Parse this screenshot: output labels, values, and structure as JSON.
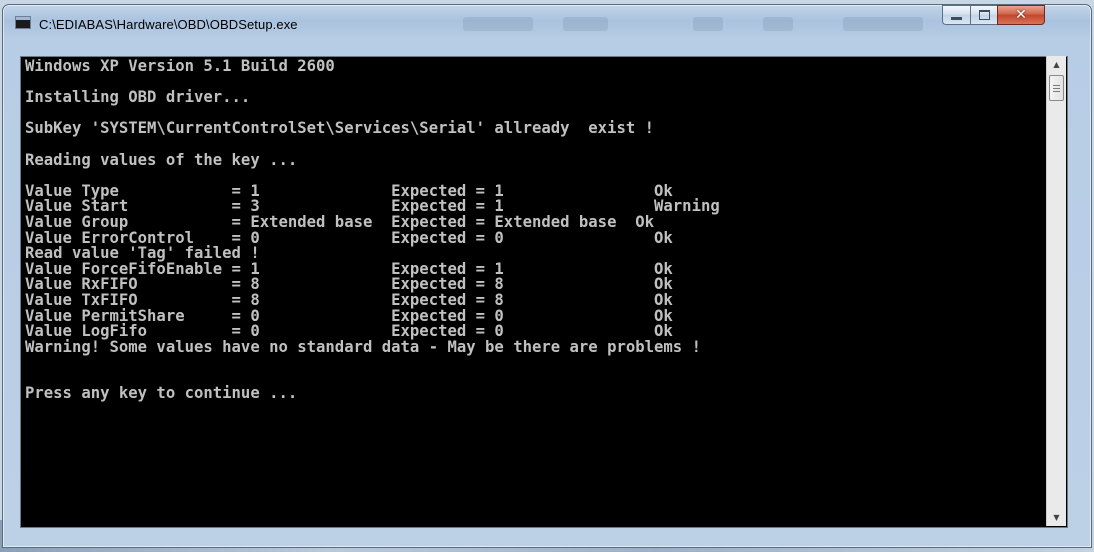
{
  "window": {
    "title": "C:\\EDIABAS\\Hardware\\OBD\\OBDSetup.exe",
    "controls": {
      "minimize": "minimize",
      "maximize": "maximize",
      "close": "close"
    }
  },
  "console": {
    "lines": [
      "Windows XP Version 5.1 Build 2600",
      "",
      "Installing OBD driver...",
      "",
      "SubKey 'SYSTEM\\CurrentControlSet\\Services\\Serial' allready  exist !",
      "",
      "Reading values of the key ...",
      "",
      "Value Type            = 1              Expected = 1                Ok",
      "Value Start           = 3              Expected = 1                Warning",
      "Value Group           = Extended base  Expected = Extended base  Ok",
      "Value ErrorControl    = 0              Expected = 0                Ok",
      "Read value 'Tag' failed !",
      "Value ForceFifoEnable = 1              Expected = 1                Ok",
      "Value RxFIFO          = 8              Expected = 8                Ok",
      "Value TxFIFO          = 8              Expected = 8                Ok",
      "Value PermitShare     = 0              Expected = 0                Ok",
      "Value LogFifo         = 0              Expected = 0                Ok",
      "Warning! Some values have no standard data - May be there are problems !",
      "",
      "",
      "Press any key to continue ...",
      "",
      "",
      "",
      "",
      ""
    ]
  }
}
